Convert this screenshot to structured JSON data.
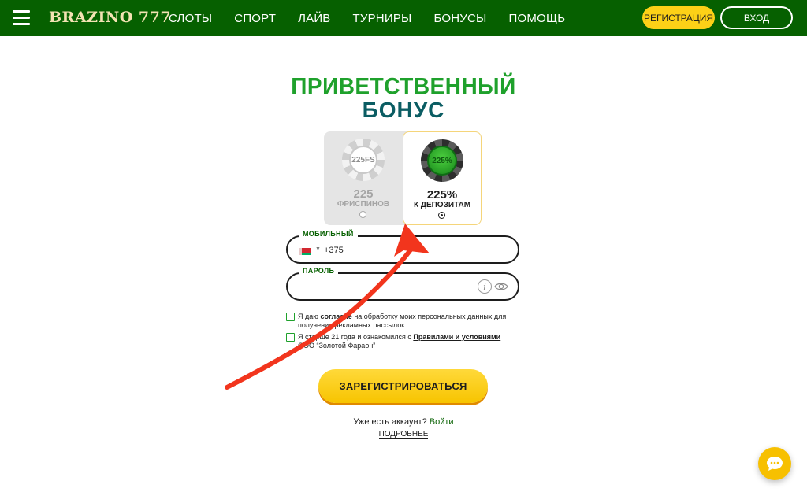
{
  "header": {
    "brand": "BRAZINO 777",
    "nav": [
      "СЛОТЫ",
      "СПОРТ",
      "ЛАЙВ",
      "ТУРНИРЫ",
      "БОНУСЫ",
      "ПОМОЩЬ"
    ],
    "register_label": "РЕГИСТРАЦИЯ",
    "login_label": "ВХОД"
  },
  "title": {
    "line1": "ПРИВЕТСТВЕННЫЙ",
    "line2": "БОНУС"
  },
  "bonus_options": {
    "freespins": {
      "chip": "225FS",
      "value": "225",
      "label": "ФРИСПИНОВ",
      "selected": false
    },
    "deposit": {
      "chip": "225%",
      "value": "225%",
      "label": "К ДЕПОЗИТАМ",
      "selected": true
    }
  },
  "form": {
    "phone_label": "МОБИЛЬНЫЙ",
    "phone_value": "+375",
    "password_label": "ПАРОЛЬ",
    "password_value": "",
    "consent_prefix": "Я даю ",
    "consent_link": "согласие",
    "consent_suffix": " на обработку моих персональных данных для получения рекламных рассылок",
    "age_prefix": "Я старше 21 года и ознакомился с ",
    "age_link": "Правилами и условиями",
    "age_suffix": " ООО “Золотой Фараон”",
    "submit_label": "ЗАРЕГИСТРИРОВАТЬСЯ",
    "have_account": "Уже есть аккаунт?",
    "login_link": "Войти",
    "more_link": "ПОДРОБНЕЕ"
  },
  "colors": {
    "header_bg": "#066000",
    "accent_yellow": "#fcd117",
    "title_green": "#1fa12c",
    "title_teal": "#0b5d63",
    "arrow_red": "#f2351d"
  }
}
